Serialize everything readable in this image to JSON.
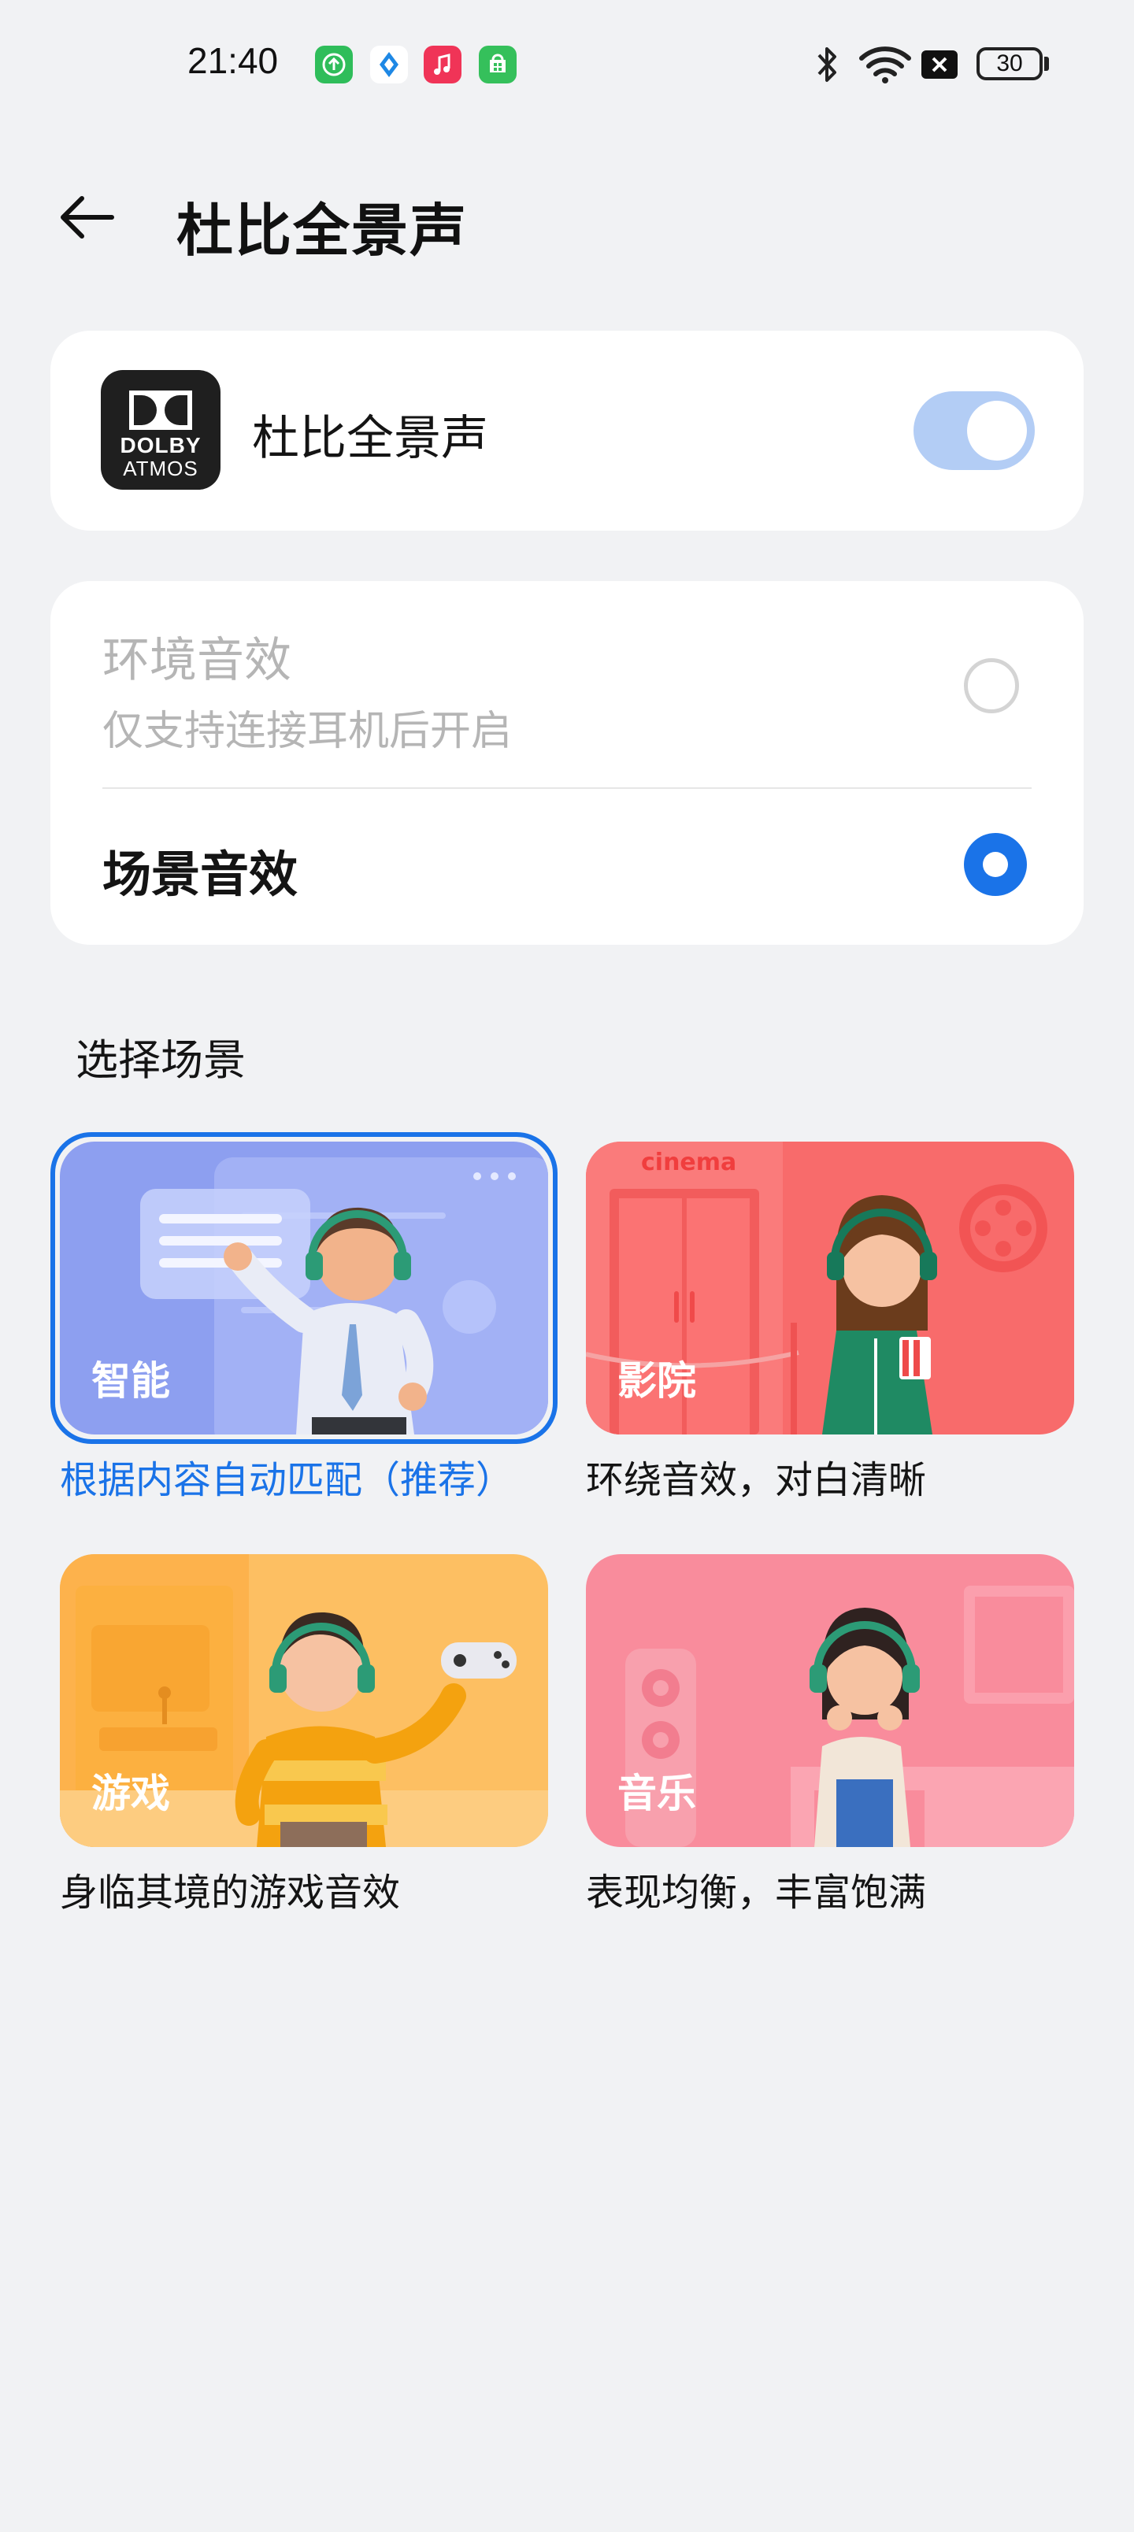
{
  "status_bar": {
    "time": "21:40",
    "battery": "30",
    "app_icons": [
      "upload-app-icon",
      "tag-app-icon",
      "music-app-icon",
      "store-app-icon"
    ],
    "right_icons": [
      "bluetooth-icon",
      "wifi-icon",
      "no-sim-icon",
      "battery-icon"
    ]
  },
  "header": {
    "title": "杜比全景声"
  },
  "dolby_card": {
    "logo_line1": "DOLBY",
    "logo_line2": "ATMOS",
    "label": "杜比全景声",
    "toggle_on": true
  },
  "mode_card": {
    "option1": {
      "title": "环境音效",
      "subtitle": "仅支持连接耳机后开启",
      "selected": false,
      "enabled": false
    },
    "option2": {
      "title": "场景音效",
      "selected": true
    }
  },
  "scenes_section": {
    "label": "选择场景",
    "scenes": [
      {
        "name": "智能",
        "desc": "根据内容自动匹配（推荐）",
        "selected": true
      },
      {
        "name": "影院",
        "desc": "环绕音效，对白清晰",
        "selected": false,
        "sign": "cinema"
      },
      {
        "name": "游戏",
        "desc": "身临其境的游戏音效",
        "selected": false
      },
      {
        "name": "音乐",
        "desc": "表现均衡，丰富饱满",
        "selected": false
      }
    ]
  },
  "colors": {
    "accent": "#1a73e8",
    "toggle_track": "#b3cdf5",
    "smart_bg": "#8d9ff0",
    "cinema_bg": "#f86b6b",
    "game_bg": "#fdbf62",
    "music_bg": "#f98c9c"
  }
}
